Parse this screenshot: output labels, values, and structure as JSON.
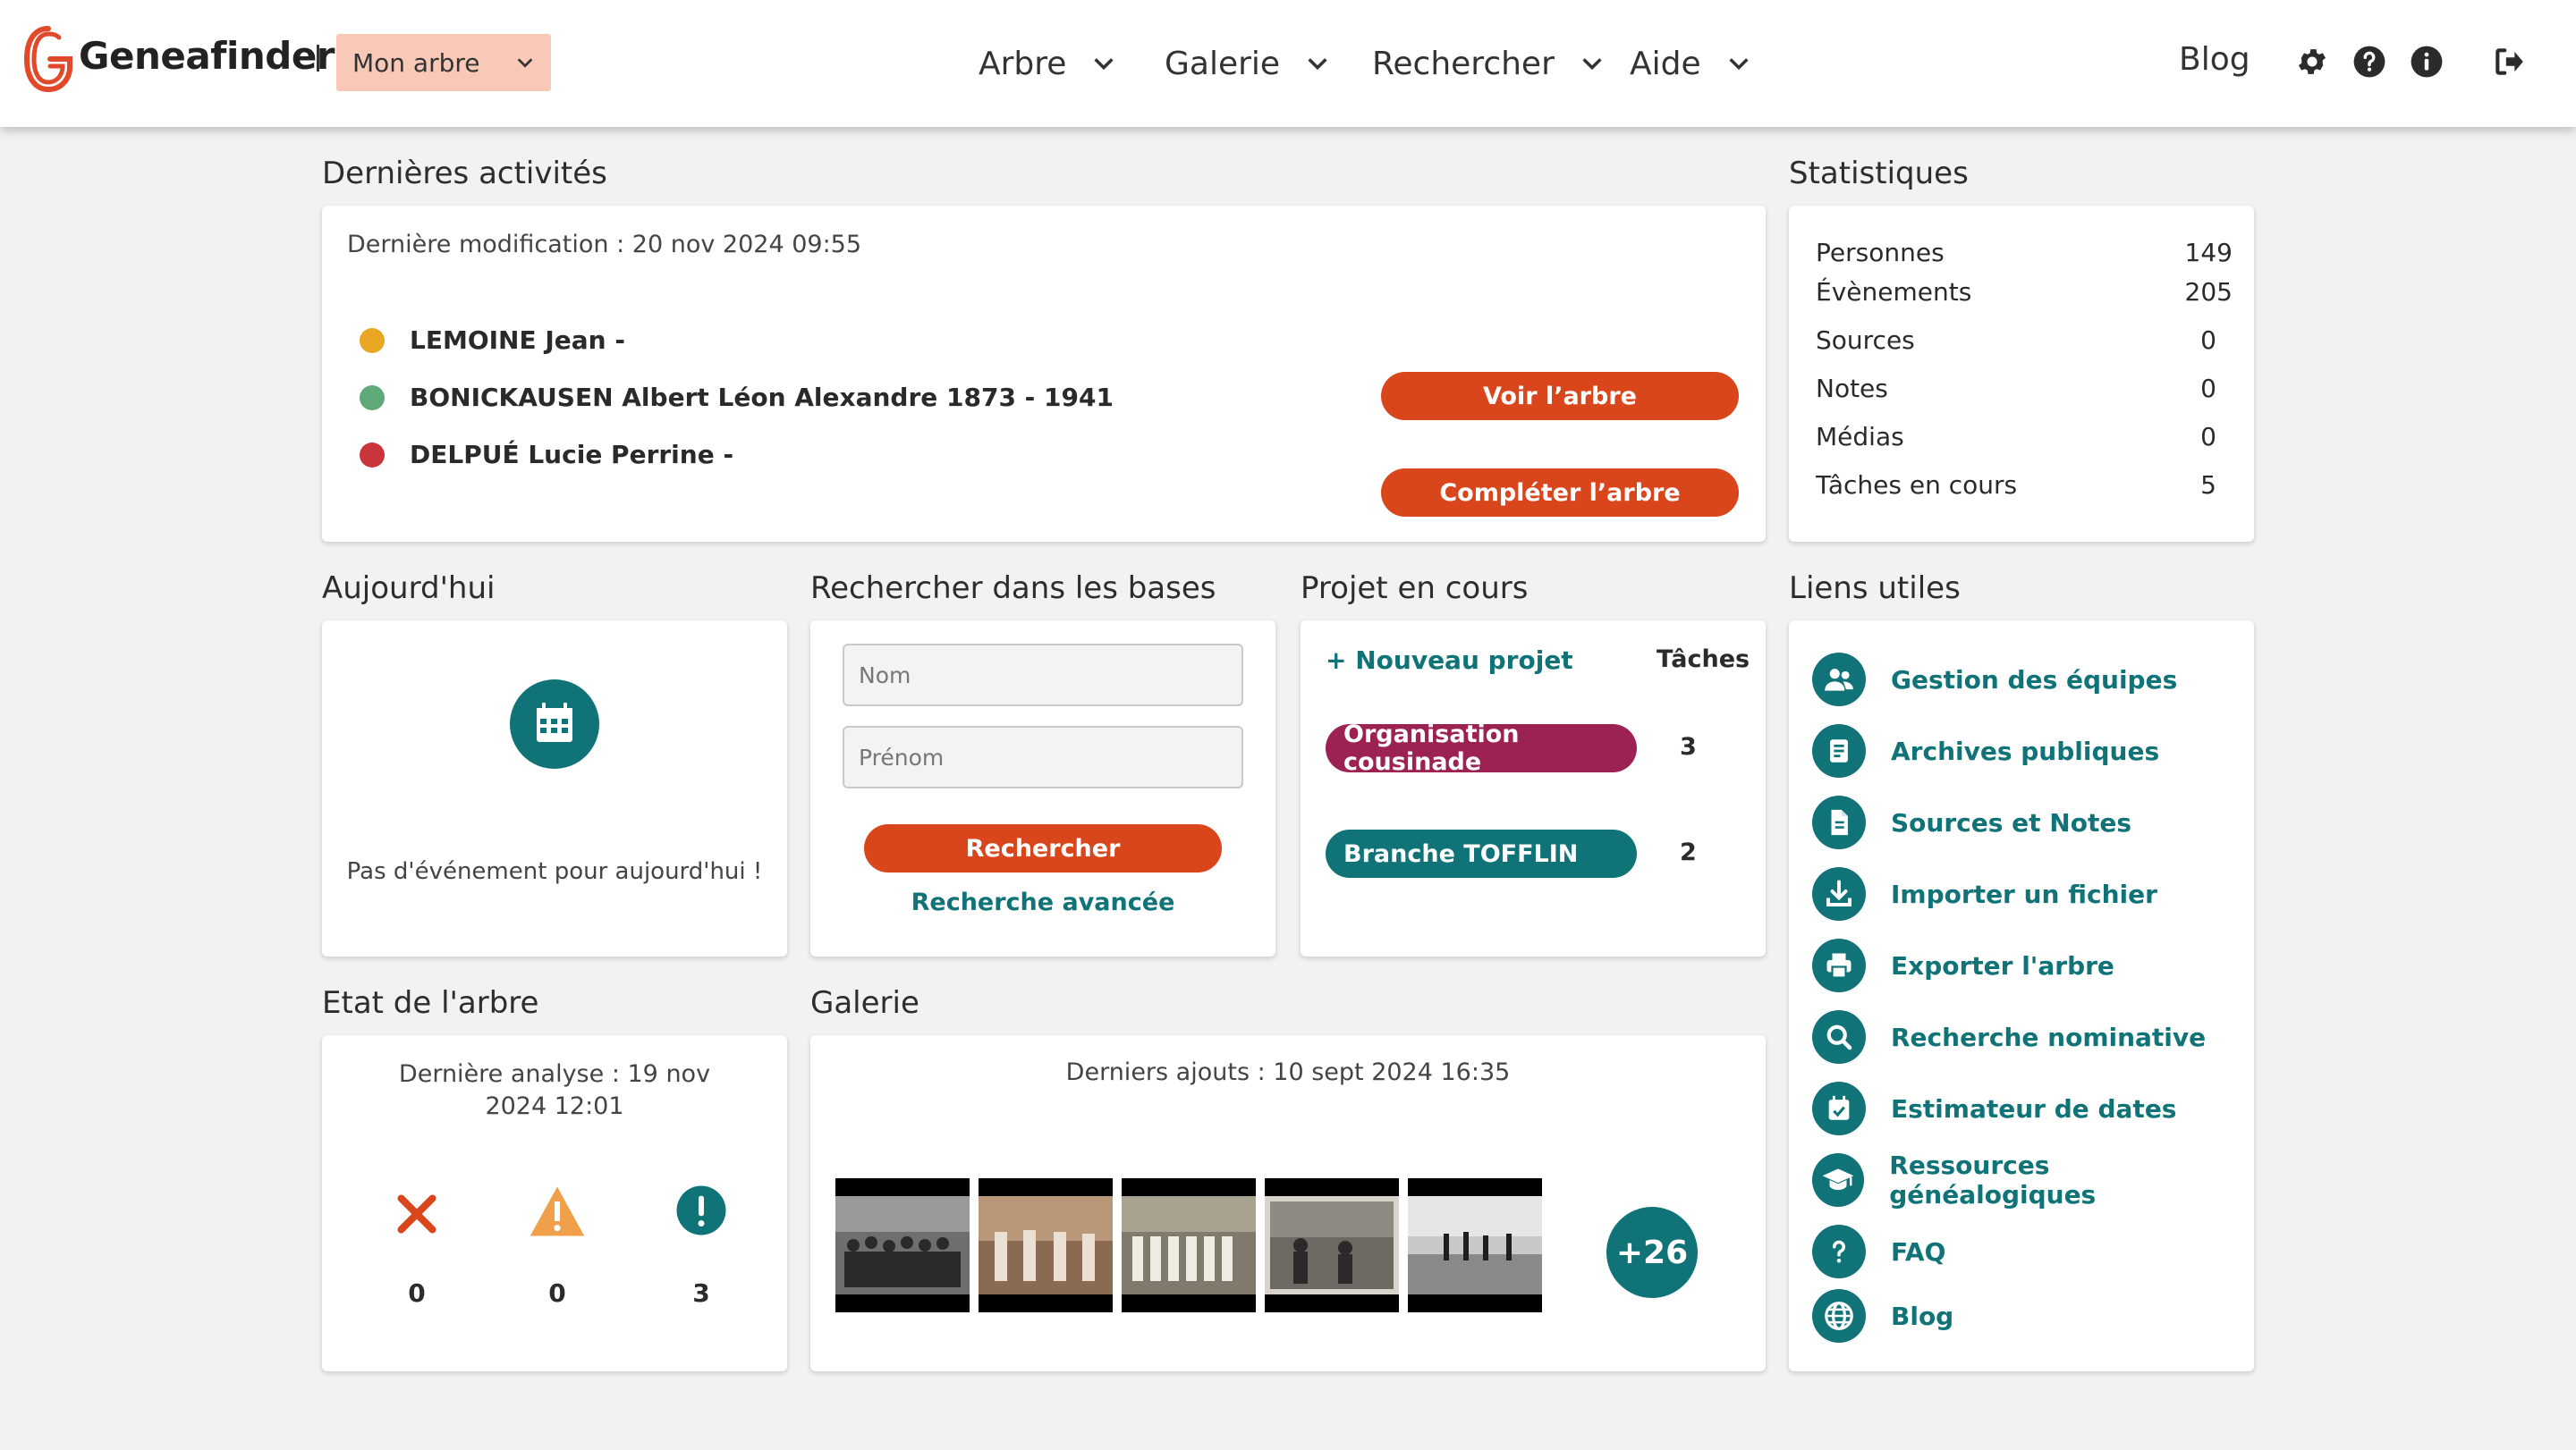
{
  "header": {
    "brand": "Geneafinder",
    "tree_selector": "Mon arbre",
    "nav": [
      {
        "label": "Arbre"
      },
      {
        "label": "Galerie"
      },
      {
        "label": "Rechercher"
      },
      {
        "label": "Aide"
      }
    ],
    "blog": "Blog",
    "icons": [
      "gear-icon",
      "help-icon",
      "info-icon",
      "logout-icon"
    ]
  },
  "activities": {
    "title": "Dernières activités",
    "last_modified": "Dernière modification : 20 nov 2024 09:55",
    "items": [
      {
        "name": "LEMOINE Jean -",
        "color": "#e8a623"
      },
      {
        "name": "BONICKAUSEN Albert Léon Alexandre 1873 - 1941",
        "color": "#5fa878"
      },
      {
        "name": "DELPUÉ Lucie Perrine -",
        "color": "#c8353a"
      }
    ],
    "view_tree": "Voir l’arbre",
    "complete_tree": "Compléter l’arbre"
  },
  "stats": {
    "title": "Statistiques",
    "rows": [
      {
        "label": "Personnes",
        "value": "149"
      },
      {
        "label": "Évènements",
        "value": "205"
      },
      {
        "label": "Sources",
        "value": "0"
      },
      {
        "label": "Notes",
        "value": "0"
      },
      {
        "label": "Médias",
        "value": "0"
      },
      {
        "label": "Tâches en cours",
        "value": "5"
      }
    ]
  },
  "today": {
    "title": "Aujourd'hui",
    "empty": "Pas d'événement pour aujourd'hui !"
  },
  "search": {
    "title": "Rechercher dans les bases",
    "name_placeholder": "Nom",
    "firstname_placeholder": "Prénom",
    "button": "Rechercher",
    "advanced": "Recherche avancée"
  },
  "projects": {
    "title": "Projet en cours",
    "new_project": "+ Nouveau projet",
    "tasks_header": "Tâches",
    "items": [
      {
        "name": "Organisation cousinade",
        "tasks": "3",
        "color": "#9b2253"
      },
      {
        "name": "Branche TOFFLIN",
        "tasks": "2",
        "color": "#0f7377"
      }
    ]
  },
  "links": {
    "title": "Liens utiles",
    "items": [
      {
        "label": "Gestion des équipes",
        "icon": "team-icon"
      },
      {
        "label": "Archives publiques",
        "icon": "archive-icon"
      },
      {
        "label": "Sources et Notes",
        "icon": "document-icon"
      },
      {
        "label": "Importer un fichier",
        "icon": "import-icon"
      },
      {
        "label": "Exporter l'arbre",
        "icon": "print-icon"
      },
      {
        "label": "Recherche nominative",
        "icon": "search-icon"
      },
      {
        "label": "Estimateur de dates",
        "icon": "calendar-check-icon"
      },
      {
        "label": "Ressources généalogiques",
        "icon": "graduation-cap-icon"
      },
      {
        "label": "FAQ",
        "icon": "question-icon"
      },
      {
        "label": "Blog",
        "icon": "globe-icon"
      }
    ]
  },
  "tree_state": {
    "title": "Etat de l'arbre",
    "last_analysis": "Dernière analyse : 19 nov 2024 12:01",
    "errors": "0",
    "warnings": "0",
    "infos": "3",
    "colors": {
      "error": "#d9461c",
      "warning": "#f0a04b",
      "info": "#0f7377"
    }
  },
  "gallery": {
    "title": "Galerie",
    "last_added": "Derniers ajouts : 10 sept 2024 16:35",
    "more": "+26"
  },
  "colors": {
    "accent": "#d9461c",
    "teal": "#0f7377",
    "background": "#f2f2f2"
  }
}
